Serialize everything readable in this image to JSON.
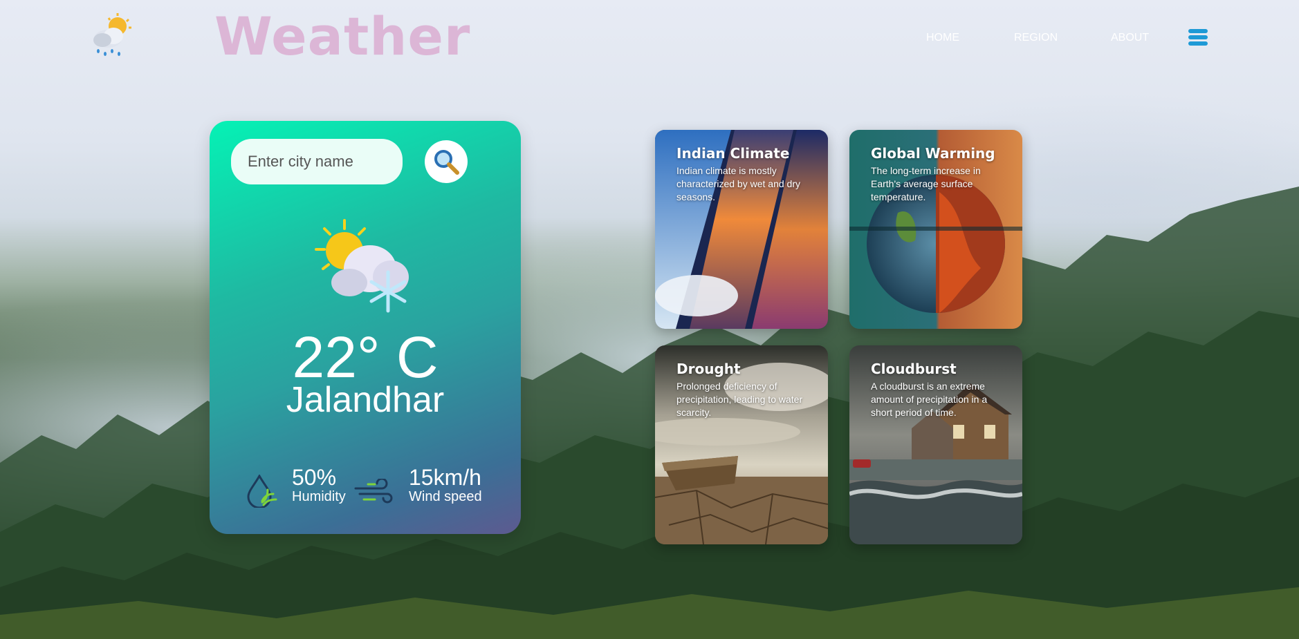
{
  "header": {
    "title": "Weather",
    "logo_icon": "cloud-sun-rain-icon",
    "nav": {
      "home": "HOME",
      "region": "REGION",
      "about": "ABOUT"
    },
    "menu_icon": "hamburger-menu-icon"
  },
  "weather": {
    "search_placeholder": "Enter city name",
    "search_icon": "magnifier-icon",
    "condition_icon": "sun-cloud-snow-icon",
    "temperature": "22° C",
    "city": "Jalandhar",
    "humidity_value": "50%",
    "humidity_label": "Humidity",
    "wind_value": "15km/h",
    "wind_label": "Wind speed"
  },
  "cards": [
    {
      "title": "Indian Climate",
      "description": "Indian climate is mostly characterized by wet and dry seasons."
    },
    {
      "title": "Global Warming",
      "description": "The long-term increase in Earth's average surface temperature."
    },
    {
      "title": "Drought",
      "description": "Prolonged deficiency of precipitation, leading to water scarcity."
    },
    {
      "title": "Cloudburst",
      "description": "A cloudburst is an extreme amount of precipitation in a short period of time."
    }
  ],
  "colors": {
    "title": "#dcb6d6",
    "card_gradient_start": "#05f2b5",
    "card_gradient_end": "#5d5a90",
    "menu": "#1e9ad6"
  }
}
